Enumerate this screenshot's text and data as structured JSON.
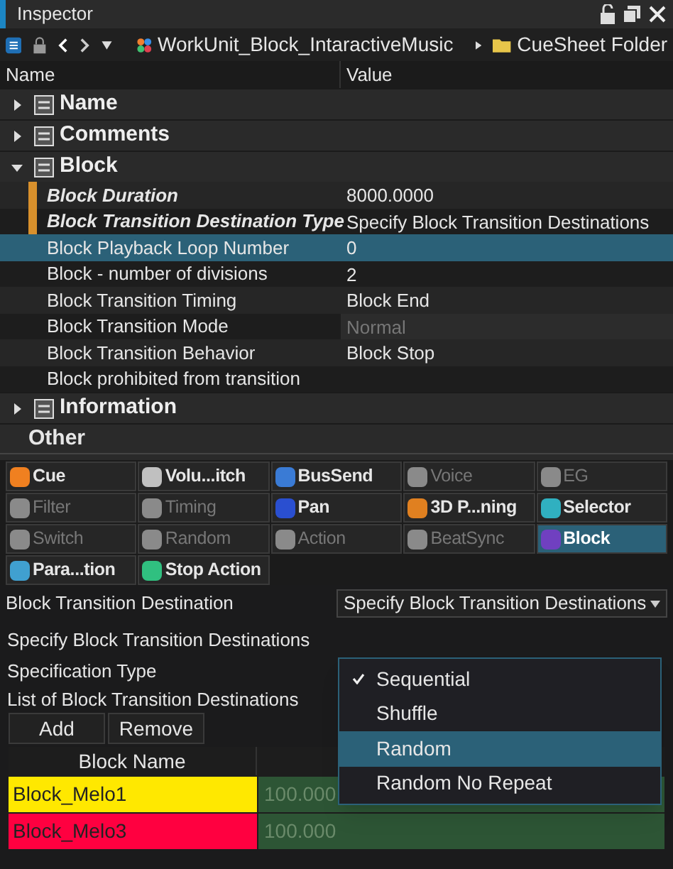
{
  "window": {
    "title": "Inspector"
  },
  "breadcrumb": [
    "WorkUnit_Block_IntaractiveMusic",
    "CueSheet Folder"
  ],
  "columns": [
    "Name",
    "Value"
  ],
  "categories": [
    {
      "label": "Name",
      "expanded": false
    },
    {
      "label": "Comments",
      "expanded": false
    },
    {
      "label": "Block",
      "expanded": true,
      "rows": [
        {
          "name": "Block Duration",
          "value": "8000.0000",
          "modified": true,
          "selected": false,
          "disabled": false
        },
        {
          "name": "Block Transition Destination Type",
          "value": "Specify Block Transition Destinations",
          "modified": true,
          "selected": false,
          "disabled": false
        },
        {
          "name": "Block Playback Loop Number",
          "value": "0",
          "modified": false,
          "selected": true,
          "disabled": false
        },
        {
          "name": "Block - number of divisions",
          "value": "2",
          "modified": false,
          "selected": false,
          "disabled": false
        },
        {
          "name": "Block Transition Timing",
          "value": "Block End",
          "modified": false,
          "selected": false,
          "disabled": false
        },
        {
          "name": "Block Transition Mode",
          "value": "Normal",
          "modified": false,
          "selected": false,
          "disabled": true
        },
        {
          "name": "Block Transition Behavior",
          "value": "Block Stop",
          "modified": false,
          "selected": false,
          "disabled": false
        },
        {
          "name": "Block prohibited from transition",
          "modified": false,
          "selected": false,
          "disabled": false
        }
      ]
    },
    {
      "label": "Information",
      "expanded": false
    }
  ],
  "other": "Other",
  "tabs": [
    {
      "label": "Cue",
      "selected": false,
      "disabled": false,
      "color": "#f08020"
    },
    {
      "label": "Volu...itch",
      "selected": false,
      "disabled": false,
      "color": "#c0c0c0"
    },
    {
      "label": "BusSend",
      "selected": false,
      "disabled": false,
      "color": "#3a7bd5"
    },
    {
      "label": "Voice",
      "selected": false,
      "disabled": true,
      "color": "#8a8a8a"
    },
    {
      "label": "EG",
      "selected": false,
      "disabled": true,
      "color": "#8a8a8a"
    },
    {
      "label": "Filter",
      "selected": false,
      "disabled": true,
      "color": "#8a8a8a"
    },
    {
      "label": "Timing",
      "selected": false,
      "disabled": true,
      "color": "#8a8a8a"
    },
    {
      "label": "Pan",
      "selected": false,
      "disabled": false,
      "color": "#2a4fd0"
    },
    {
      "label": "3D P...ning",
      "selected": false,
      "disabled": false,
      "color": "#e08020"
    },
    {
      "label": "Selector",
      "selected": false,
      "disabled": false,
      "color": "#30b0c0"
    },
    {
      "label": "Switch",
      "selected": false,
      "disabled": true,
      "color": "#8a8a8a"
    },
    {
      "label": "Random",
      "selected": false,
      "disabled": true,
      "color": "#8a8a8a"
    },
    {
      "label": "Action",
      "selected": false,
      "disabled": true,
      "color": "#8a8a8a"
    },
    {
      "label": "BeatSync",
      "selected": false,
      "disabled": true,
      "color": "#8a8a8a"
    },
    {
      "label": "Block",
      "selected": true,
      "disabled": false,
      "color": "#7040c0"
    },
    {
      "label": "Para...tion",
      "selected": false,
      "disabled": false,
      "color": "#40a0d0"
    },
    {
      "label": "Stop Action",
      "selected": false,
      "disabled": false,
      "color": "#30c080"
    }
  ],
  "destination": {
    "label": "Block Transition Destination",
    "value": "Specify Block Transition Destinations"
  },
  "section_title": "Specify Block Transition Destinations",
  "spec_label": "Specification Type",
  "list_label": "List of Block Transition Destinations",
  "buttons": [
    "Add",
    "Remove"
  ],
  "table": {
    "columns": [
      "Block Name"
    ],
    "rows": [
      {
        "name": "Block_Melo1",
        "value": "100.000",
        "color": "#ffe800"
      },
      {
        "name": "Block_Melo3",
        "value": "100.000",
        "color": "#ff0040"
      }
    ]
  },
  "menu": [
    {
      "label": "Sequential",
      "checked": true,
      "selected": false
    },
    {
      "label": "Shuffle",
      "checked": false,
      "selected": false
    },
    {
      "label": "Random",
      "checked": false,
      "selected": true
    },
    {
      "label": "Random No Repeat",
      "checked": false,
      "selected": false
    }
  ]
}
